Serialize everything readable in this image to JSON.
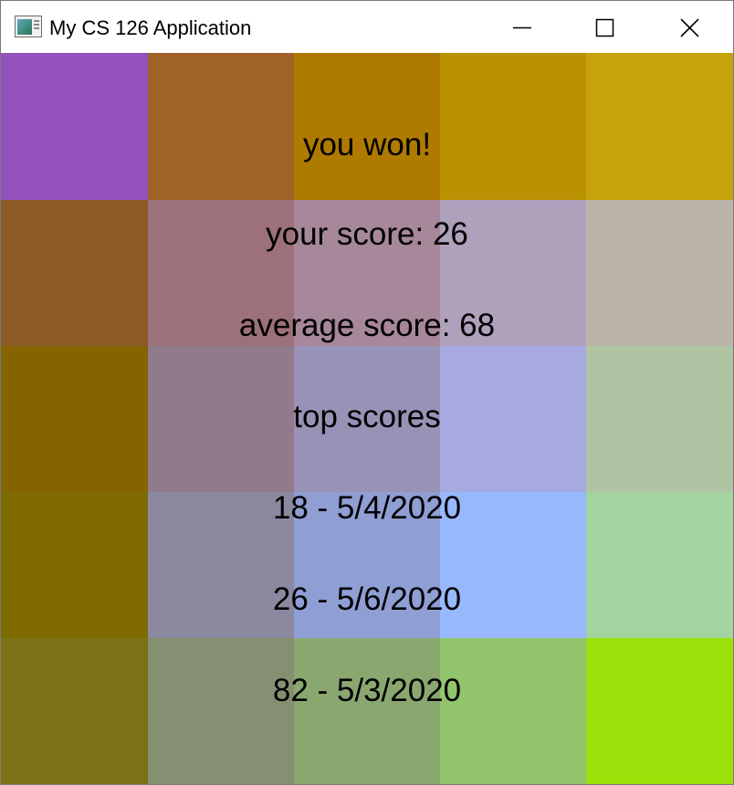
{
  "window": {
    "title": "My CS 126 Application",
    "controls": [
      "minimize-icon",
      "maximize-icon",
      "close-icon"
    ]
  },
  "grid": {
    "rows": 5,
    "columns": 5,
    "colors": [
      [
        "#9251bd",
        "#a16327",
        "#ae7a00",
        "#ba9100",
        "#c6a30b"
      ],
      [
        "#8d5b28",
        "#9d717a",
        "#a7879a",
        "#afa0bb",
        "#bab4a8"
      ],
      [
        "#856300",
        "#917a8b",
        "#9992b7",
        "#a7aae0",
        "#b0c3a3"
      ],
      [
        "#7f6a00",
        "#8a89a0",
        "#8f9fd4",
        "#98b8fe",
        "#a3d4a0"
      ],
      [
        "#7b7215",
        "#858f72",
        "#8aa770",
        "#91c46b",
        "#9ae009"
      ]
    ]
  },
  "results": {
    "headline": "you won!",
    "your_score": "your score: 26",
    "average_score": "average score: 68",
    "top_scores_heading": "top scores",
    "top_scores": [
      "18 - 5/4/2020",
      "26 - 5/6/2020",
      "82 - 5/3/2020"
    ]
  }
}
